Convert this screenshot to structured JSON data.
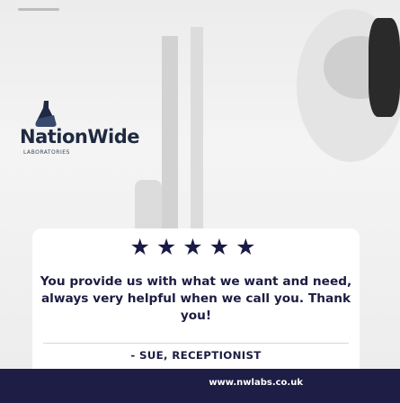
{
  "brand": {
    "name": "NationWide",
    "tagline": "LABORATORIES",
    "logo_icon": "flask-mark-icon"
  },
  "rating": {
    "stars": 5,
    "max": 5,
    "star_glyph": "★★★★★"
  },
  "testimonial": {
    "quote": "You provide us with what we want and need, always very helpful when we call you. Thank you!",
    "author": "- SUE, RECEPTIONIST"
  },
  "footer": {
    "url": "www.nwlabs.co.uk"
  },
  "colors": {
    "navy": "#1d1d45",
    "text": "#1c1c42",
    "card": "#ffffff"
  }
}
